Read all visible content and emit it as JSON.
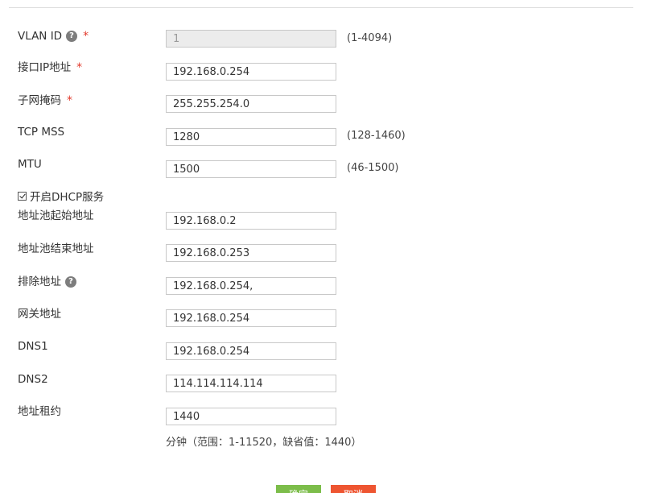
{
  "form": {
    "vlan_id": {
      "label": "VLAN ID",
      "value": "1",
      "range": "(1-4094)",
      "required_mark": "*",
      "help_glyph": "?"
    },
    "ip": {
      "label": "接口IP地址",
      "value": "192.168.0.254",
      "required_mark": "*"
    },
    "mask": {
      "label": "子网掩码",
      "value": "255.255.254.0",
      "required_mark": "*"
    },
    "tcp_mss": {
      "label": "TCP MSS",
      "value": "1280",
      "range": "(128-1460)"
    },
    "mtu": {
      "label": "MTU",
      "value": "1500",
      "range": "(46-1500)"
    },
    "dhcp": {
      "label": "开启DHCP服务",
      "checked": true
    },
    "pool_start": {
      "label": "地址池起始地址",
      "value": "192.168.0.2"
    },
    "pool_end": {
      "label": "地址池结束地址",
      "value": "192.168.0.253"
    },
    "exclude": {
      "label": "排除地址",
      "value": "192.168.0.254,",
      "help_glyph": "?"
    },
    "gateway": {
      "label": "网关地址",
      "value": "192.168.0.254"
    },
    "dns1": {
      "label": "DNS1",
      "value": "192.168.0.254"
    },
    "dns2": {
      "label": "DNS2",
      "value": "114.114.114.114"
    },
    "lease": {
      "label": "地址租约",
      "value": "1440",
      "note": "分钟（范围：1-11520，缺省值：1440）"
    }
  },
  "buttons": {
    "ok": "确定",
    "cancel": "取消"
  },
  "colors": {
    "required": "#e23a2c",
    "ok_button": "#7cbd4a",
    "cancel_button": "#ee5531"
  }
}
